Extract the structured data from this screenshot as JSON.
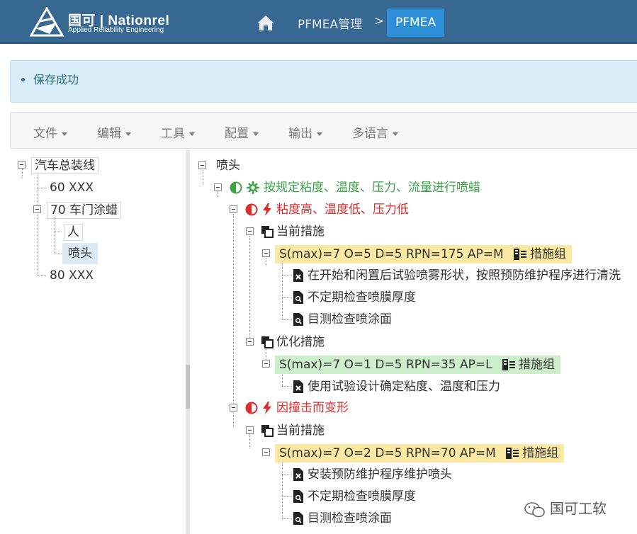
{
  "header": {
    "logo_main": "国可 | Nationrel",
    "logo_sub": "Applied Reliability Engineering",
    "breadcrumb_parent": "PFMEA管理",
    "breadcrumb_separator": ">",
    "breadcrumb_current": "PFMEA"
  },
  "alert": {
    "message": "保存成功"
  },
  "menu": {
    "items": [
      "文件",
      "编辑",
      "工具",
      "配置",
      "输出",
      "多语言"
    ]
  },
  "left_tree": {
    "root": "汽车总装线",
    "children": [
      "60 XXX",
      "70 车门涂蜡",
      "80 XXX"
    ],
    "grandchildren": [
      "人",
      "喷头"
    ]
  },
  "right_tree": {
    "root": "喷头",
    "function": "按规定粘度、温度、压力、流量进行喷蜡",
    "failure1": "粘度高、温度低、压力低",
    "current_label": "当前措施",
    "optimize_label": "优化措施",
    "rpn1": "S(max)=7 O=5 D=5 RPN=175 AP=M",
    "group_label": "措施组",
    "actions1": [
      "在开始和闲置后试验喷雾形状，按照预防维护程序进行清洗",
      "不定期检查喷膜厚度",
      "目测检查喷涂面"
    ],
    "rpn2": "S(max)=7 O=1 D=5 RPN=35 AP=L",
    "actions2": [
      "使用试验设计确定粘度、温度和压力"
    ],
    "failure2": "因撞击而变形",
    "rpn3": "S(max)=7 O=2 D=5 RPN=70 AP=M",
    "actions3": [
      "安装预防维护程序维护喷头",
      "不定期检查喷膜厚度",
      "目测检查喷涂面"
    ]
  },
  "watermark": "国可工软",
  "colors": {
    "header": "#376891",
    "active_crumb": "#2c8fd8",
    "alert_bg": "#d9edf7",
    "green": "#3da34a",
    "red": "#e02b2b"
  }
}
